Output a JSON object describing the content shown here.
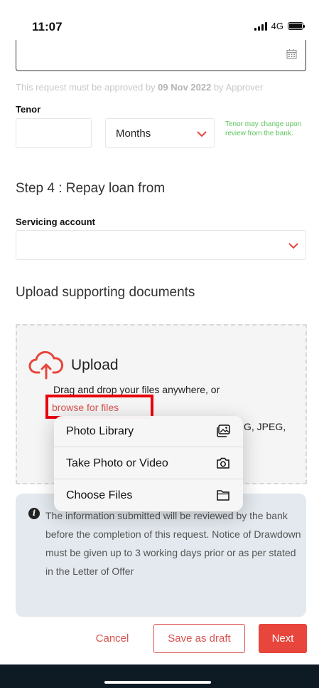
{
  "status_bar": {
    "time": "11:07",
    "network": "4G",
    "battery_level": 1.0
  },
  "date_field": {
    "value": "",
    "icon": "calendar-icon"
  },
  "approval_note": {
    "prefix": "This request must be approved by ",
    "date": "09 Nov 2022",
    "suffix": " by Approver"
  },
  "tenor": {
    "label": "Tenor",
    "value": "",
    "unit": "Months",
    "hint": "Tenor may change upon review from the bank."
  },
  "step4": {
    "title": "Step 4 : Repay loan from",
    "servicing_label": "Servicing account",
    "servicing_value": ""
  },
  "upload": {
    "section_title": "Upload supporting documents",
    "heading": "Upload",
    "drag_text": "Drag and drop your files anywhere, or",
    "browse_link": "browse for files",
    "file_types_fragment": "G, JPEG,"
  },
  "context_menu": {
    "items": [
      {
        "label": "Photo Library",
        "icon": "photo-library-icon"
      },
      {
        "label": "Take Photo or Video",
        "icon": "camera-icon"
      },
      {
        "label": "Choose Files",
        "icon": "folder-icon"
      }
    ]
  },
  "info": {
    "text": "The information submitted will be reviewed by the bank before the completion of this request. Notice of Drawdown must be given up to 3 working days prior or as per stated in the Letter of Offer"
  },
  "actions": {
    "cancel": "Cancel",
    "save_draft": "Save as draft",
    "next": "Next"
  },
  "colors": {
    "accent": "#e8453c",
    "link": "#d9534f",
    "hint": "#5cc45c",
    "highlight": "#e8000c",
    "info_bg": "#e3e9ee"
  }
}
